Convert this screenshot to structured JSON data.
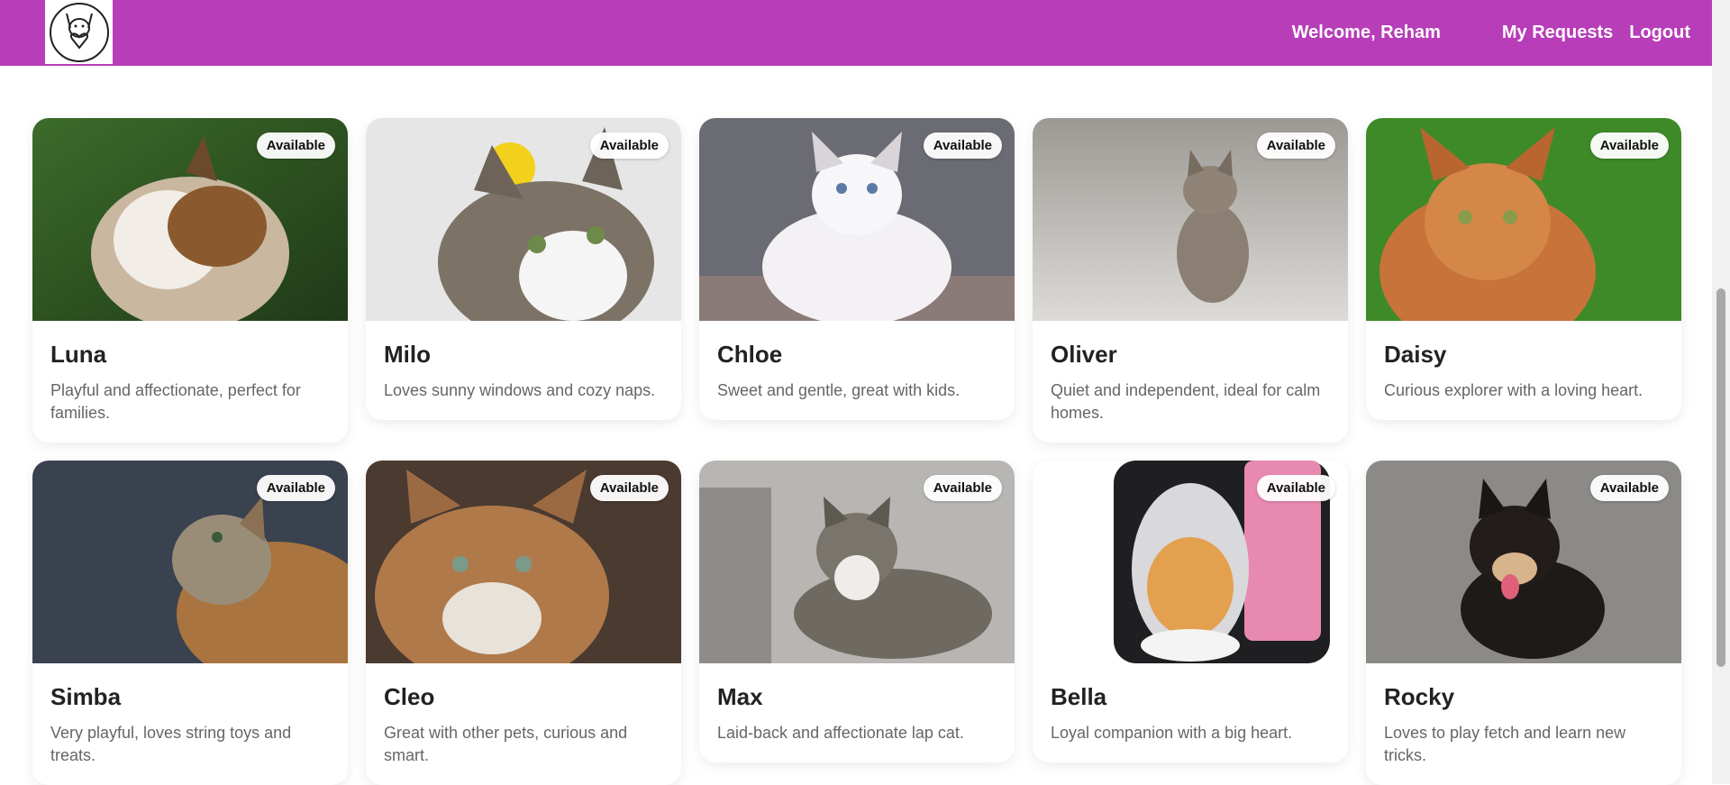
{
  "nav": {
    "logo_icon": "dog-heart-logo",
    "welcome": "Welcome, Reham",
    "my_requests": "My Requests",
    "logout": "Logout",
    "bg_color": "#b83db9"
  },
  "pets": [
    {
      "name": "Luna",
      "status": "Available",
      "description": "Playful and affectionate, perfect for families."
    },
    {
      "name": "Milo",
      "status": "Available",
      "description": "Loves sunny windows and cozy naps."
    },
    {
      "name": "Chloe",
      "status": "Available",
      "description": "Sweet and gentle, great with kids."
    },
    {
      "name": "Oliver",
      "status": "Available",
      "description": "Quiet and independent, ideal for calm homes."
    },
    {
      "name": "Daisy",
      "status": "Available",
      "description": "Curious explorer with a loving heart."
    },
    {
      "name": "Simba",
      "status": "Available",
      "description": "Very playful, loves string toys and treats."
    },
    {
      "name": "Cleo",
      "status": "Available",
      "description": "Great with other pets, curious and smart."
    },
    {
      "name": "Max",
      "status": "Available",
      "description": "Laid-back and affectionate lap cat."
    },
    {
      "name": "Bella",
      "status": "Available",
      "description": "Loyal companion with a big heart."
    },
    {
      "name": "Rocky",
      "status": "Available",
      "description": "Loves to play fetch and learn new tricks."
    }
  ]
}
